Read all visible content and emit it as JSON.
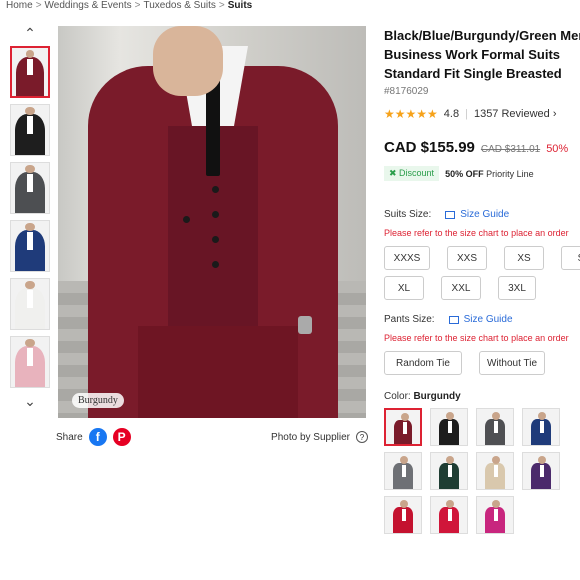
{
  "breadcrumb": {
    "items": [
      "Home",
      "Weddings & Events",
      "Tuxedos & Suits",
      "Suits"
    ]
  },
  "gallery": {
    "thumbs": [
      {
        "name": "burgundy",
        "color": "#7a1b2a"
      },
      {
        "name": "black",
        "color": "#1e1e1e"
      },
      {
        "name": "grey",
        "color": "#4d4f52"
      },
      {
        "name": "blue",
        "color": "#1f3b7a"
      },
      {
        "name": "white",
        "color": "#f0f0ee"
      },
      {
        "name": "pink",
        "color": "#e8b3bd"
      }
    ],
    "main_label": "Burgundy"
  },
  "share": {
    "label": "Share",
    "facebook": "f",
    "pinterest": "P",
    "photo_by": "Photo by Supplier",
    "help": "?"
  },
  "product": {
    "title_lines": [
      "Black/Blue/Burgundy/Green Men",
      "Business Work Formal Suits",
      "Standard Fit Single Breasted"
    ],
    "sku": "#8176029",
    "stars": "★★★★★",
    "rating": "4.8",
    "reviews": "1357 Reviewed ›",
    "price": "CAD $155.99",
    "old_price": "CAD $311.01",
    "off": "50%",
    "discount_tag": "✖ Discount",
    "discount_bold": "50% OFF",
    "discount_text": " Priority Line"
  },
  "suits_size": {
    "label": "Suits Size:",
    "guide": "Size Guide",
    "note": "Please refer to the size chart to place an order",
    "options": [
      "XXXS",
      "XXS",
      "XS",
      "S",
      "XL",
      "XXL",
      "3XL"
    ]
  },
  "pants_size": {
    "label": "Pants Size:",
    "guide": "Size Guide",
    "note": "Please refer to the size chart to place an order",
    "options": [
      "Random Tie",
      "Without Tie"
    ]
  },
  "color": {
    "label": "Color: ",
    "selected": "Burgundy",
    "swatches": [
      {
        "name": "burgundy",
        "hex": "#7a1b2a"
      },
      {
        "name": "black",
        "hex": "#1e1e1e"
      },
      {
        "name": "grey",
        "hex": "#4f5053"
      },
      {
        "name": "navy",
        "hex": "#1f3b7a"
      },
      {
        "name": "light-grey",
        "hex": "#6e7075"
      },
      {
        "name": "dark-green",
        "hex": "#1f3d33"
      },
      {
        "name": "champagne",
        "hex": "#d9c8ad"
      },
      {
        "name": "purple",
        "hex": "#4b2a6b"
      },
      {
        "name": "red",
        "hex": "#c4122f"
      },
      {
        "name": "scarlet",
        "hex": "#d0163a"
      },
      {
        "name": "fuchsia",
        "hex": "#c8267e"
      }
    ]
  }
}
